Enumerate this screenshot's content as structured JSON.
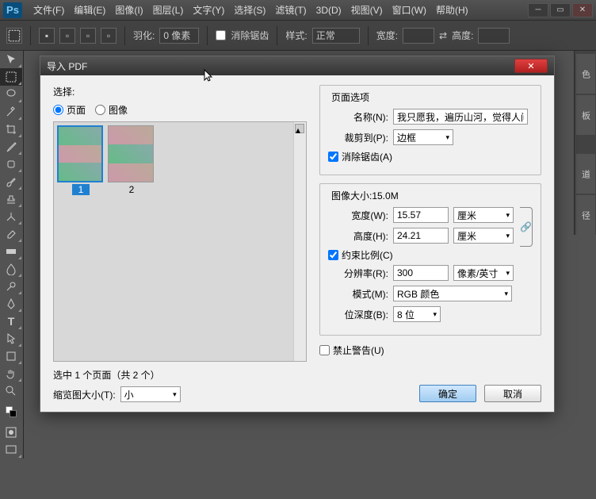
{
  "app": {
    "logo": "Ps"
  },
  "menu": {
    "file": "文件(F)",
    "edit": "编辑(E)",
    "image": "图像(I)",
    "layer": "图层(L)",
    "type": "文字(Y)",
    "select": "选择(S)",
    "filter": "滤镜(T)",
    "threed": "3D(D)",
    "view": "视图(V)",
    "window": "窗口(W)",
    "help": "帮助(H)"
  },
  "options": {
    "feather_label": "羽化:",
    "feather_value": "0 像素",
    "antialias": "消除锯齿",
    "style_label": "样式:",
    "style_value": "正常",
    "width_label": "宽度:",
    "height_label": "高度:"
  },
  "rightpanels": {
    "color": "色",
    "swatch": "板",
    "channel": "道",
    "path": "径"
  },
  "dialog": {
    "title": "导入 PDF",
    "select_label": "选择:",
    "radio_page": "页面",
    "radio_image": "图像",
    "thumbs": [
      {
        "n": "1"
      },
      {
        "n": "2"
      }
    ],
    "status": "选中 1 个页面（共 2 个）",
    "thumbsize_label": "缩览图大小(T):",
    "thumbsize_value": "小",
    "po_title": "页面选项",
    "name_label": "名称(N):",
    "name_value": "我只愿我，遍历山河，觉得人间值",
    "crop_label": "裁剪到(P):",
    "crop_value": "边框",
    "aa_label": "消除锯齿(A)",
    "is_title": "图像大小:15.0M",
    "width_label": "宽度(W):",
    "width_value": "15.57",
    "width_unit": "厘米",
    "height_label": "高度(H):",
    "height_value": "24.21",
    "height_unit": "厘米",
    "constrain_label": "约束比例(C)",
    "res_label": "分辨率(R):",
    "res_value": "300",
    "res_unit": "像素/英寸",
    "mode_label": "模式(M):",
    "mode_value": "RGB 颜色",
    "depth_label": "位深度(B):",
    "depth_value": "8 位",
    "suppress_label": "禁止警告(U)",
    "ok": "确定",
    "cancel": "取消"
  }
}
